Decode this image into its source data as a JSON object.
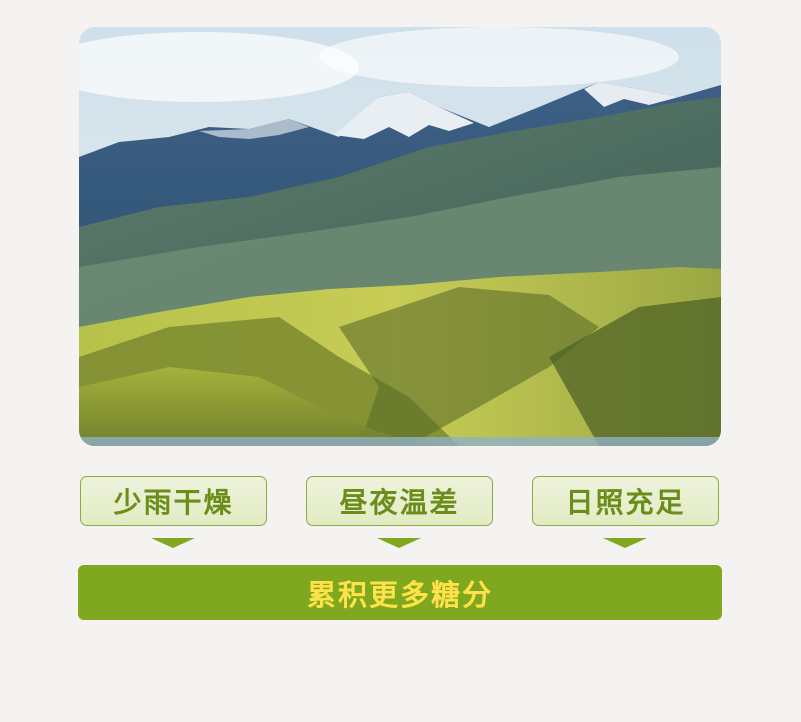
{
  "photo": {
    "alt": "mountain-landscape"
  },
  "tags": [
    {
      "label": "少雨干燥"
    },
    {
      "label": "昼夜温差"
    },
    {
      "label": "日照充足"
    }
  ],
  "banner": {
    "label": "累积更多糖分"
  },
  "colors": {
    "accent_green": "#7fa81e",
    "tag_text": "#6b8e1b",
    "banner_text": "#ffe24a",
    "background": "#f4f3f1"
  }
}
